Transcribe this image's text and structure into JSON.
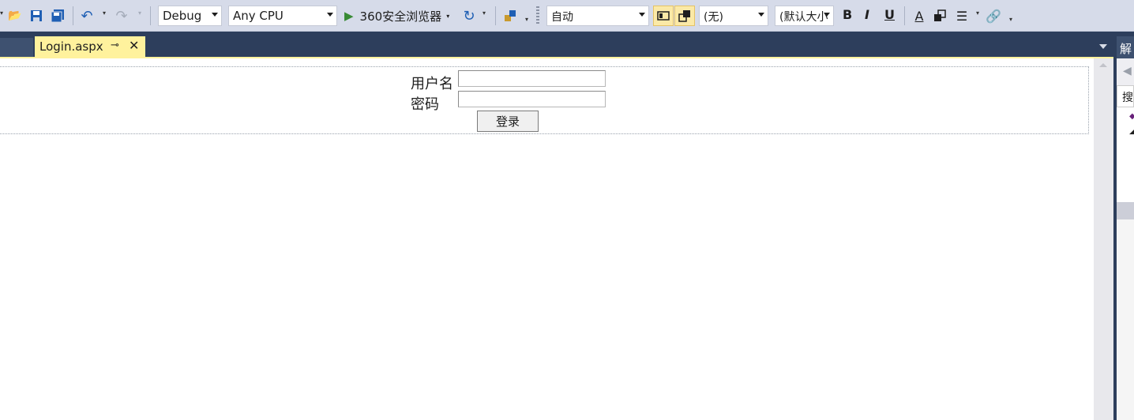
{
  "toolbar": {
    "config_value": "Debug",
    "platform_value": "Any CPU",
    "run_label": "360安全浏览器",
    "block_format_value": "自动",
    "font_value": "(无)",
    "font_size_value": "(默认大小",
    "bold_label": "B",
    "italic_label": "I",
    "underline_label": "U",
    "icons": [
      "save-icon",
      "save-all-icon",
      "undo-icon",
      "redo-icon",
      "play-icon",
      "refresh-icon",
      "find-icon",
      "bold-icon",
      "italic-icon",
      "underline-icon",
      "font-color-icon",
      "align-icon",
      "link-icon"
    ]
  },
  "tabs": {
    "active": "Login.aspx"
  },
  "form": {
    "username_label": "用户名",
    "password_label": "密码",
    "username_value": "",
    "password_value": "",
    "login_button": "登录"
  },
  "right_panel": {
    "title": "解",
    "search_label": "搜"
  },
  "colors": {
    "toolbar_bg": "#d6dbe9",
    "tab_active_bg": "#fff29d",
    "frame_bg": "#2d3e5c",
    "run_green": "#388a34"
  }
}
